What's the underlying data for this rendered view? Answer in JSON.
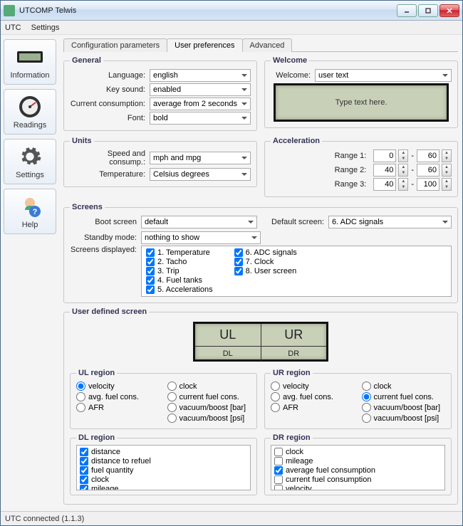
{
  "window": {
    "title": "UTCOMP Telwis"
  },
  "menu": {
    "utc": "UTC",
    "settings": "Settings"
  },
  "sidebar": [
    {
      "name": "information",
      "label": "Information"
    },
    {
      "name": "readings",
      "label": "Readings"
    },
    {
      "name": "settings",
      "label": "Settings"
    },
    {
      "name": "help",
      "label": "Help"
    }
  ],
  "tabs": [
    {
      "name": "config",
      "label": "Configuration parameters",
      "active": false
    },
    {
      "name": "userpref",
      "label": "User preferences",
      "active": true
    },
    {
      "name": "advanced",
      "label": "Advanced",
      "active": false
    }
  ],
  "general": {
    "legend": "General",
    "language_label": "Language:",
    "language_value": "english",
    "keysound_label": "Key sound:",
    "keysound_value": "enabled",
    "curcons_label": "Current consumption:",
    "curcons_value": "average from 2 seconds",
    "font_label": "Font:",
    "font_value": "bold"
  },
  "welcome": {
    "legend": "Welcome",
    "label": "Welcome:",
    "value": "user text",
    "lcd_text": "Type text here."
  },
  "units": {
    "legend": "Units",
    "speed_label": "Speed and consump.:",
    "speed_value": "mph and mpg",
    "temp_label": "Temperature:",
    "temp_value": "Celsius degrees"
  },
  "accel": {
    "legend": "Acceleration",
    "r1_label": "Range 1:",
    "r1_from": "0",
    "r1_to": "60",
    "r2_label": "Range 2:",
    "r2_from": "40",
    "r2_to": "60",
    "r3_label": "Range 3:",
    "r3_from": "40",
    "r3_to": "100",
    "dash": "-"
  },
  "screens": {
    "legend": "Screens",
    "boot_label": "Boot screen",
    "boot_value": "default",
    "default_label": "Default screen:",
    "default_value": "6. ADC signals",
    "standby_label": "Standby mode:",
    "standby_value": "nothing to show",
    "displayed_label": "Screens displayed:",
    "items_left": [
      "1. Temperature",
      "2. Tacho",
      "3. Trip",
      "4. Fuel tanks",
      "5. Accelerations"
    ],
    "items_right": [
      "6. ADC signals",
      "7. Clock",
      "8. User screen"
    ]
  },
  "uds": {
    "legend": "User defined screen",
    "lcd": {
      "ul": "UL",
      "ur": "UR",
      "dl": "DL",
      "dr": "DR"
    },
    "ul_legend": "UL region",
    "ur_legend": "UR region",
    "dl_legend": "DL region",
    "dr_legend": "DR region",
    "opts": {
      "velocity": "velocity",
      "clock": "clock",
      "avg": "avg. fuel cons.",
      "cur": "current fuel cons.",
      "afr": "AFR",
      "vb_bar": "vacuum/boost [bar]",
      "vb_psi": "vacuum/boost [psi]"
    },
    "ul_selected": "velocity",
    "ur_selected": "cur",
    "dl_items": [
      {
        "label": "distance",
        "checked": true
      },
      {
        "label": "distance to refuel",
        "checked": true
      },
      {
        "label": "fuel quantity",
        "checked": true
      },
      {
        "label": "clock",
        "checked": true
      },
      {
        "label": "mileage",
        "checked": true
      }
    ],
    "dr_items": [
      {
        "label": "clock",
        "checked": false
      },
      {
        "label": "mileage",
        "checked": false
      },
      {
        "label": "average fuel consumption",
        "checked": true
      },
      {
        "label": "current fuel consumption",
        "checked": false
      },
      {
        "label": "velocity",
        "checked": false
      }
    ]
  },
  "status": {
    "text": "UTC connected (1.1.3)"
  }
}
